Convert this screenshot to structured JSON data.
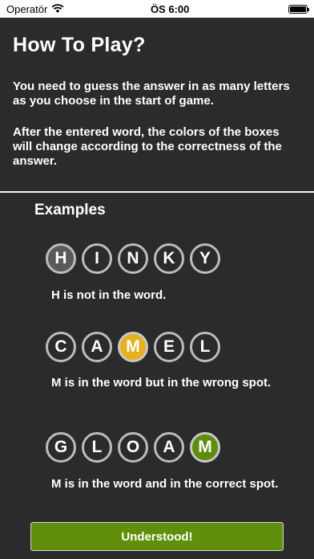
{
  "status_bar": {
    "carrier": "Operatör",
    "time": "ÖS 6:00",
    "battery_level": 1.0
  },
  "title": "How To Play?",
  "intro": [
    "You need to guess the answer in as many letters as you choose in the start of game.",
    "After the entered word, the colors of the boxes will change according to the correctness of the answer."
  ],
  "examples": {
    "title": "Examples",
    "items": [
      {
        "word": [
          "H",
          "I",
          "N",
          "K",
          "Y"
        ],
        "states": [
          "absent",
          "empty",
          "empty",
          "empty",
          "empty"
        ],
        "text": "H is not in the word."
      },
      {
        "word": [
          "C",
          "A",
          "M",
          "E",
          "L"
        ],
        "states": [
          "empty",
          "empty",
          "present",
          "empty",
          "empty"
        ],
        "text": "M is in the word but in the wrong spot."
      },
      {
        "word": [
          "G",
          "L",
          "O",
          "A",
          "M"
        ],
        "states": [
          "empty",
          "empty",
          "empty",
          "empty",
          "correct"
        ],
        "text": "M is in the word and in the correct spot."
      }
    ]
  },
  "button": {
    "label": "Understood!"
  },
  "colors": {
    "background": "#2b2b2b",
    "absent": "#5a5a5a",
    "present": "#e7b020",
    "correct": "#5f8c0c",
    "button": "#5f8f0b"
  }
}
